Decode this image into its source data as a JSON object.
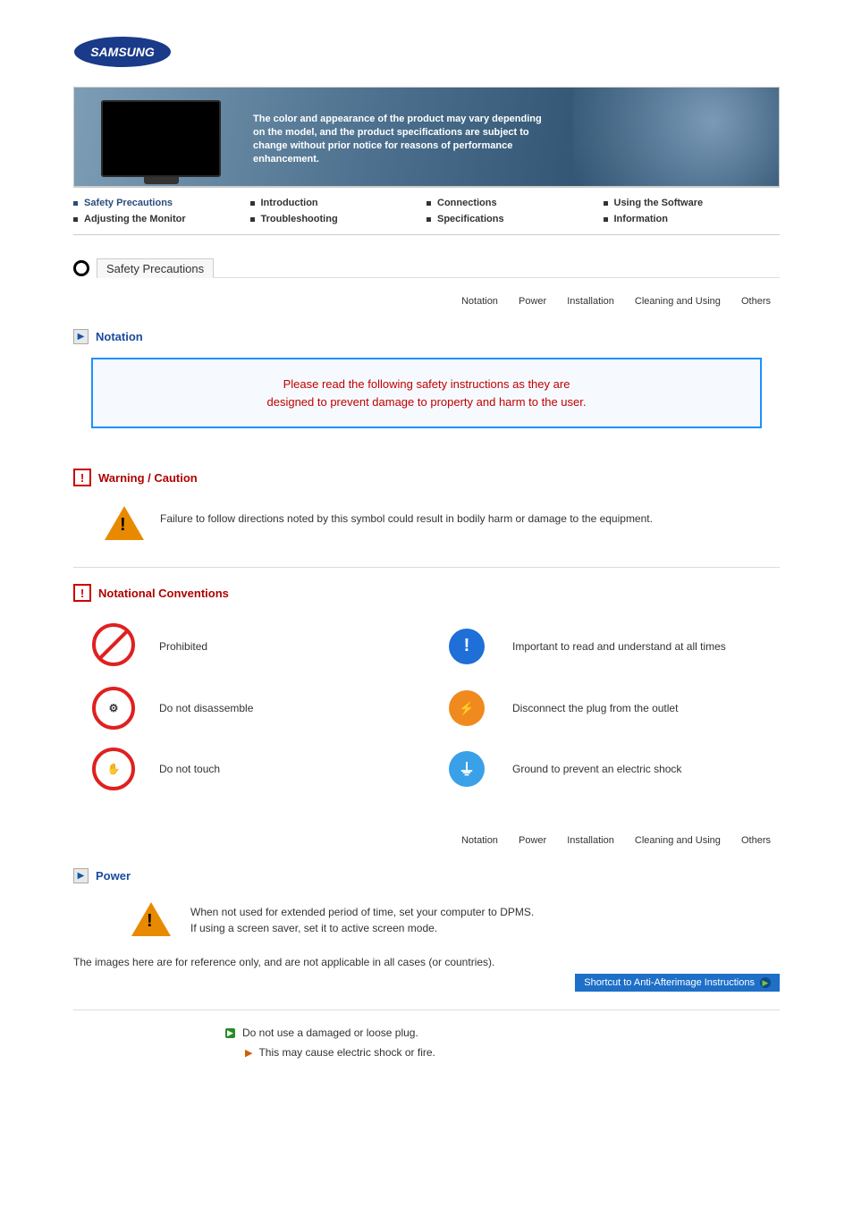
{
  "brand": "SAMSUNG",
  "banner_text": "The color and appearance of the product may vary depending on the model, and the product specifications are subject to change without prior notice for reasons of performance enhancement.",
  "nav_row1": [
    "Safety Precautions",
    "Introduction",
    "Connections",
    "Using the Software"
  ],
  "nav_row2": [
    "Adjusting the Monitor",
    "Troubleshooting",
    "Specifications",
    "Information"
  ],
  "section_title": "Safety Precautions",
  "subnav": [
    "Notation",
    "Power",
    "Installation",
    "Cleaning and Using",
    "Others"
  ],
  "heading_notation": "Notation",
  "notice_line1": "Please read the following safety instructions as they are",
  "notice_line2": "designed to prevent damage to property and harm to the user.",
  "warning_heading": "Warning / Caution",
  "warning_text": "Failure to follow directions noted by this symbol could result in bodily harm or damage to the equipment.",
  "conventions_heading": "Notational Conventions",
  "conv": {
    "prohibited": "Prohibited",
    "important": "Important to read and understand at all times",
    "disassemble": "Do not disassemble",
    "unplug": "Disconnect the plug from the outlet",
    "notouch": "Do not touch",
    "ground": "Ground to prevent an electric shock"
  },
  "heading_power": "Power",
  "power_line1": "When not used for extended period of time, set your computer to DPMS.",
  "power_line2": "If using a screen saver, set it to active screen mode.",
  "reference_note": "The images here are for reference only, and are not applicable in all cases (or countries).",
  "shortcut_label": "Shortcut to Anti-Afterimage Instructions",
  "bullet_main": "Do not use a damaged or loose plug.",
  "bullet_sub": "This may cause electric shock or fire."
}
